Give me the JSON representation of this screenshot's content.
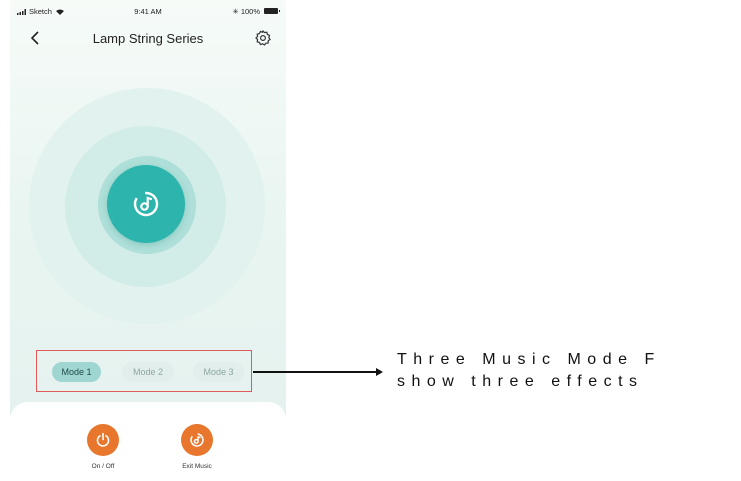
{
  "status_bar": {
    "carrier": "Sketch",
    "time": "9:41 AM",
    "battery": "100%"
  },
  "nav": {
    "back_icon": "chevron-left-icon",
    "title": "Lamp String Series",
    "settings_icon": "gear-icon"
  },
  "music_button_icon": "music-note-icon",
  "modes": [
    {
      "label": "Mode 1",
      "selected": true
    },
    {
      "label": "Mode 2",
      "selected": false
    },
    {
      "label": "Mode 3",
      "selected": false
    }
  ],
  "controls": {
    "power_label": "On / Off",
    "exit_label": "Exit Music"
  },
  "annotation": {
    "line1": "Three Music Mode F",
    "line2": "show three effects"
  },
  "colors": {
    "accent": "#2db4ac",
    "control": "#e8762c",
    "highlight_box": "#e05a5a"
  }
}
